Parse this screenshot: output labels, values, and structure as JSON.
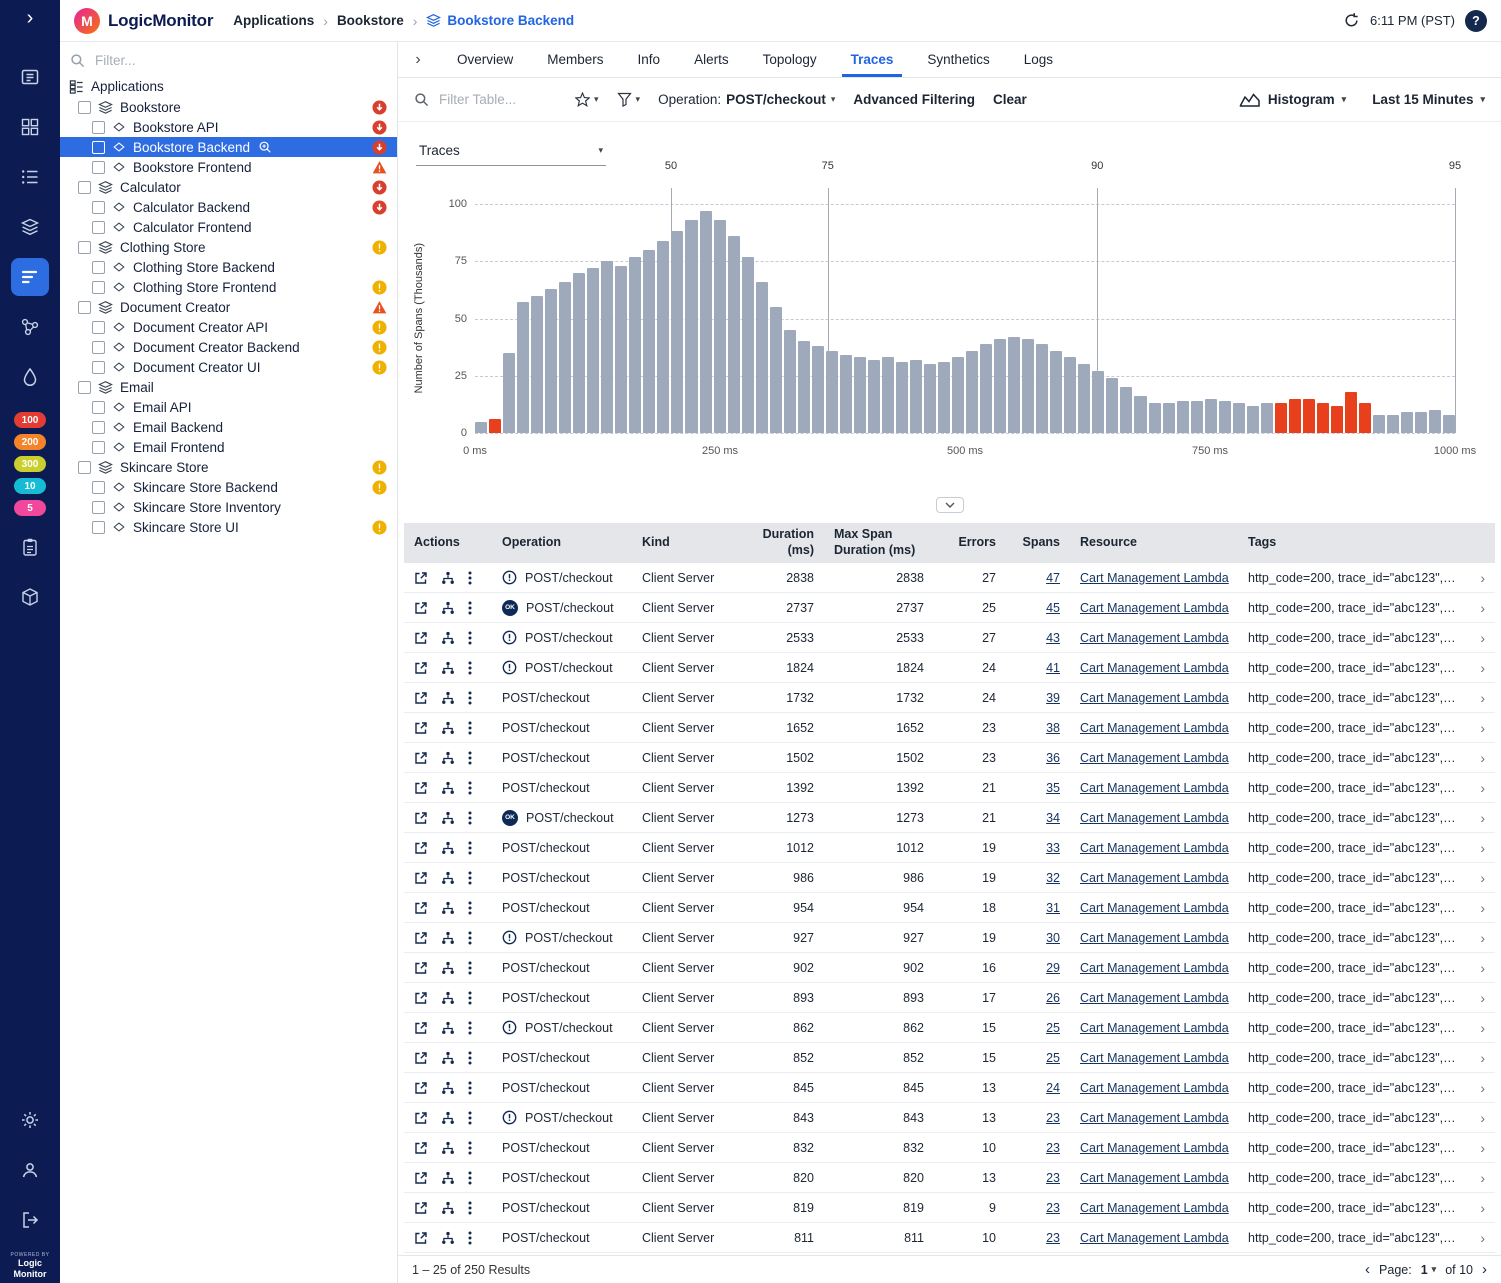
{
  "rail": {
    "badges": [
      {
        "label": "100",
        "color": "#e23c33"
      },
      {
        "label": "200",
        "color": "#f4832a"
      },
      {
        "label": "300",
        "color": "#c9cf2e"
      },
      {
        "label": "10",
        "color": "#15bcd4"
      },
      {
        "label": "5",
        "color": "#f1479c"
      }
    ],
    "powered_by": "POWERED BY",
    "powered_brand": "Logic Monitor"
  },
  "header": {
    "brand": "LogicMonitor",
    "breadcrumb": {
      "level1": "Applications",
      "level2": "Bookstore",
      "current": "Bookstore Backend"
    },
    "time": "6:11 PM (PST)",
    "help": "?"
  },
  "sidebar": {
    "filter_placeholder": "Filter...",
    "root_label": "Applications",
    "items": [
      {
        "label": "Bookstore",
        "type": "group",
        "level": 1,
        "badge": "critical"
      },
      {
        "label": "Bookstore API",
        "type": "service",
        "level": 2,
        "badge": "critical"
      },
      {
        "label": "Bookstore Backend",
        "type": "service",
        "level": 2,
        "badge": "critical",
        "selected": true
      },
      {
        "label": "Bookstore Frontend",
        "type": "service",
        "level": 2,
        "badge": "warning"
      },
      {
        "label": "Calculator",
        "type": "group",
        "level": 1,
        "badge": "critical"
      },
      {
        "label": "Calculator Backend",
        "type": "service",
        "level": 2,
        "badge": "critical"
      },
      {
        "label": "Calculator Frontend",
        "type": "service",
        "level": 2,
        "badge": "none"
      },
      {
        "label": "Clothing Store",
        "type": "group",
        "level": 1,
        "badge": "minor"
      },
      {
        "label": "Clothing Store Backend",
        "type": "service",
        "level": 2,
        "badge": "none"
      },
      {
        "label": "Clothing Store Frontend",
        "type": "service",
        "level": 2,
        "badge": "minor"
      },
      {
        "label": "Document Creator",
        "type": "group",
        "level": 1,
        "badge": "warning"
      },
      {
        "label": "Document Creator API",
        "type": "service",
        "level": 2,
        "badge": "minor"
      },
      {
        "label": "Document Creator Backend",
        "type": "service",
        "level": 2,
        "badge": "minor"
      },
      {
        "label": "Document Creator UI",
        "type": "service",
        "level": 2,
        "badge": "minor"
      },
      {
        "label": "Email",
        "type": "group",
        "level": 1,
        "badge": "none"
      },
      {
        "label": "Email API",
        "type": "service",
        "level": 2,
        "badge": "none"
      },
      {
        "label": "Email Backend",
        "type": "service",
        "level": 2,
        "badge": "none"
      },
      {
        "label": "Email Frontend",
        "type": "service",
        "level": 2,
        "badge": "none"
      },
      {
        "label": "Skincare Store",
        "type": "group",
        "level": 1,
        "badge": "minor"
      },
      {
        "label": "Skincare Store Backend",
        "type": "service",
        "level": 2,
        "badge": "minor"
      },
      {
        "label": "Skincare Store Inventory",
        "type": "service",
        "level": 2,
        "badge": "none"
      },
      {
        "label": "Skincare Store UI",
        "type": "service",
        "level": 2,
        "badge": "minor"
      }
    ]
  },
  "tabs": {
    "active_index": 5,
    "items": [
      "Overview",
      "Members",
      "Info",
      "Alerts",
      "Topology",
      "Traces",
      "Synthetics",
      "Logs"
    ]
  },
  "toolbar": {
    "filter_placeholder": "Filter Table...",
    "operation_label": "Operation:",
    "operation_value": "POST/checkout",
    "advanced_filtering": "Advanced Filtering",
    "clear": "Clear",
    "histogram": "Histogram",
    "time_range": "Last 15 Minutes"
  },
  "view_select": {
    "value": "Traces"
  },
  "chart_data": {
    "type": "bar",
    "title": "Trace duration histogram",
    "ylabel": "Number of Spans (Thousands)",
    "yticks": [
      0,
      25,
      50,
      75,
      100
    ],
    "ylim": [
      0,
      100
    ],
    "xtick_labels": [
      "0 ms",
      "250 ms",
      "500 ms",
      "750 ms",
      "1000 ms"
    ],
    "xlim_ms": [
      0,
      1000
    ],
    "bar_values_thousands": [
      5,
      6,
      35,
      57,
      60,
      63,
      66,
      70,
      72,
      75,
      73,
      77,
      80,
      84,
      88,
      93,
      97,
      93,
      86,
      77,
      66,
      55,
      45,
      40,
      38,
      36,
      34,
      33,
      32,
      33,
      31,
      32,
      30,
      31,
      33,
      36,
      39,
      41,
      42,
      41,
      39,
      36,
      33,
      30,
      27,
      24,
      20,
      16,
      13,
      13,
      14,
      14,
      15,
      14,
      13,
      12,
      13,
      13,
      15,
      15,
      13,
      12,
      18,
      13,
      8,
      8,
      9,
      9,
      10,
      8
    ],
    "error_bar_indices": [
      1,
      57,
      58,
      59,
      60,
      61,
      62,
      63
    ],
    "percentiles": [
      {
        "label": "50",
        "ms": 200
      },
      {
        "label": "75",
        "ms": 360
      },
      {
        "label": "90",
        "ms": 635
      },
      {
        "label": "95",
        "ms": 1000
      }
    ],
    "bar_color": "#9fa9bc",
    "error_color": "#e8401c",
    "grid": true
  },
  "table": {
    "headers": [
      "Actions",
      "Operation",
      "Kind",
      "Duration (ms)",
      "Max Span Duration (ms)",
      "Errors",
      "Spans",
      "Resource",
      "Tags"
    ],
    "status_ok_label": "OK",
    "rows": [
      {
        "status": "error",
        "operation": "POST/checkout",
        "kind": "Client Server",
        "duration": 2838,
        "max_span_duration": 2838,
        "errors": 27,
        "spans": 47,
        "resource": "Cart Management Lambda",
        "tags": "http_code=200, trace_id=\"abc123\", span…"
      },
      {
        "status": "ok",
        "operation": "POST/checkout",
        "kind": "Client Server",
        "duration": 2737,
        "max_span_duration": 2737,
        "errors": 25,
        "spans": 45,
        "resource": "Cart Management Lambda",
        "tags": "http_code=200, trace_id=\"abc123\", span…"
      },
      {
        "status": "error",
        "operation": "POST/checkout",
        "kind": "Client Server",
        "duration": 2533,
        "max_span_duration": 2533,
        "errors": 27,
        "spans": 43,
        "resource": "Cart Management Lambda",
        "tags": "http_code=200, trace_id=\"abc123\", span…"
      },
      {
        "status": "error",
        "operation": "POST/checkout",
        "kind": "Client Server",
        "duration": 1824,
        "max_span_duration": 1824,
        "errors": 24,
        "spans": 41,
        "resource": "Cart Management Lambda",
        "tags": "http_code=200, trace_id=\"abc123\", span…"
      },
      {
        "status": "none",
        "operation": "POST/checkout",
        "kind": "Client Server",
        "duration": 1732,
        "max_span_duration": 1732,
        "errors": 24,
        "spans": 39,
        "resource": "Cart Management Lambda",
        "tags": "http_code=200, trace_id=\"abc123\", span…"
      },
      {
        "status": "none",
        "operation": "POST/checkout",
        "kind": "Client Server",
        "duration": 1652,
        "max_span_duration": 1652,
        "errors": 23,
        "spans": 38,
        "resource": "Cart Management Lambda",
        "tags": "http_code=200, trace_id=\"abc123\", span…"
      },
      {
        "status": "none",
        "operation": "POST/checkout",
        "kind": "Client Server",
        "duration": 1502,
        "max_span_duration": 1502,
        "errors": 23,
        "spans": 36,
        "resource": "Cart Management Lambda",
        "tags": "http_code=200, trace_id=\"abc123\", span…"
      },
      {
        "status": "none",
        "operation": "POST/checkout",
        "kind": "Client Server",
        "duration": 1392,
        "max_span_duration": 1392,
        "errors": 21,
        "spans": 35,
        "resource": "Cart Management Lambda",
        "tags": "http_code=200, trace_id=\"abc123\", span…"
      },
      {
        "status": "ok",
        "operation": "POST/checkout",
        "kind": "Client Server",
        "duration": 1273,
        "max_span_duration": 1273,
        "errors": 21,
        "spans": 34,
        "resource": "Cart Management Lambda",
        "tags": "http_code=200, trace_id=\"abc123\", span…"
      },
      {
        "status": "none",
        "operation": "POST/checkout",
        "kind": "Client Server",
        "duration": 1012,
        "max_span_duration": 1012,
        "errors": 19,
        "spans": 33,
        "resource": "Cart Management Lambda",
        "tags": "http_code=200, trace_id=\"abc123\", span…"
      },
      {
        "status": "none",
        "operation": "POST/checkout",
        "kind": "Client Server",
        "duration": 986,
        "max_span_duration": 986,
        "errors": 19,
        "spans": 32,
        "resource": "Cart Management Lambda",
        "tags": "http_code=200, trace_id=\"abc123\", span…"
      },
      {
        "status": "none",
        "operation": "POST/checkout",
        "kind": "Client Server",
        "duration": 954,
        "max_span_duration": 954,
        "errors": 18,
        "spans": 31,
        "resource": "Cart Management Lambda",
        "tags": "http_code=200, trace_id=\"abc123\", span…"
      },
      {
        "status": "error",
        "operation": "POST/checkout",
        "kind": "Client Server",
        "duration": 927,
        "max_span_duration": 927,
        "errors": 19,
        "spans": 30,
        "resource": "Cart Management Lambda",
        "tags": "http_code=200, trace_id=\"abc123\", span…"
      },
      {
        "status": "none",
        "operation": "POST/checkout",
        "kind": "Client Server",
        "duration": 902,
        "max_span_duration": 902,
        "errors": 16,
        "spans": 29,
        "resource": "Cart Management Lambda",
        "tags": "http_code=200, trace_id=\"abc123\", span…"
      },
      {
        "status": "none",
        "operation": "POST/checkout",
        "kind": "Client Server",
        "duration": 893,
        "max_span_duration": 893,
        "errors": 17,
        "spans": 26,
        "resource": "Cart Management Lambda",
        "tags": "http_code=200, trace_id=\"abc123\", span…"
      },
      {
        "status": "error",
        "operation": "POST/checkout",
        "kind": "Client Server",
        "duration": 862,
        "max_span_duration": 862,
        "errors": 15,
        "spans": 25,
        "resource": "Cart Management Lambda",
        "tags": "http_code=200, trace_id=\"abc123\", span…"
      },
      {
        "status": "none",
        "operation": "POST/checkout",
        "kind": "Client Server",
        "duration": 852,
        "max_span_duration": 852,
        "errors": 15,
        "spans": 25,
        "resource": "Cart Management Lambda",
        "tags": "http_code=200, trace_id=\"abc123\", span…"
      },
      {
        "status": "none",
        "operation": "POST/checkout",
        "kind": "Client Server",
        "duration": 845,
        "max_span_duration": 845,
        "errors": 13,
        "spans": 24,
        "resource": "Cart Management Lambda",
        "tags": "http_code=200, trace_id=\"abc123\", span…"
      },
      {
        "status": "error",
        "operation": "POST/checkout",
        "kind": "Client Server",
        "duration": 843,
        "max_span_duration": 843,
        "errors": 13,
        "spans": 23,
        "resource": "Cart Management Lambda",
        "tags": "http_code=200, trace_id=\"abc123\", span…"
      },
      {
        "status": "none",
        "operation": "POST/checkout",
        "kind": "Client Server",
        "duration": 832,
        "max_span_duration": 832,
        "errors": 10,
        "spans": 23,
        "resource": "Cart Management Lambda",
        "tags": "http_code=200, trace_id=\"abc123\", span…"
      },
      {
        "status": "none",
        "operation": "POST/checkout",
        "kind": "Client Server",
        "duration": 820,
        "max_span_duration": 820,
        "errors": 13,
        "spans": 23,
        "resource": "Cart Management Lambda",
        "tags": "http_code=200, trace_id=\"abc123\", span…"
      },
      {
        "status": "none",
        "operation": "POST/checkout",
        "kind": "Client Server",
        "duration": 819,
        "max_span_duration": 819,
        "errors": 9,
        "spans": 23,
        "resource": "Cart Management Lambda",
        "tags": "http_code=200, trace_id=\"abc123\", span…"
      },
      {
        "status": "none",
        "operation": "POST/checkout",
        "kind": "Client Server",
        "duration": 811,
        "max_span_duration": 811,
        "errors": 10,
        "spans": 23,
        "resource": "Cart Management Lambda",
        "tags": "http_code=200, trace_id=\"abc123\", span…"
      }
    ],
    "results_summary": "1 – 25 of 250 Results",
    "pagination": {
      "page_label": "Page:",
      "page": "1",
      "of_label": "of 10"
    }
  }
}
